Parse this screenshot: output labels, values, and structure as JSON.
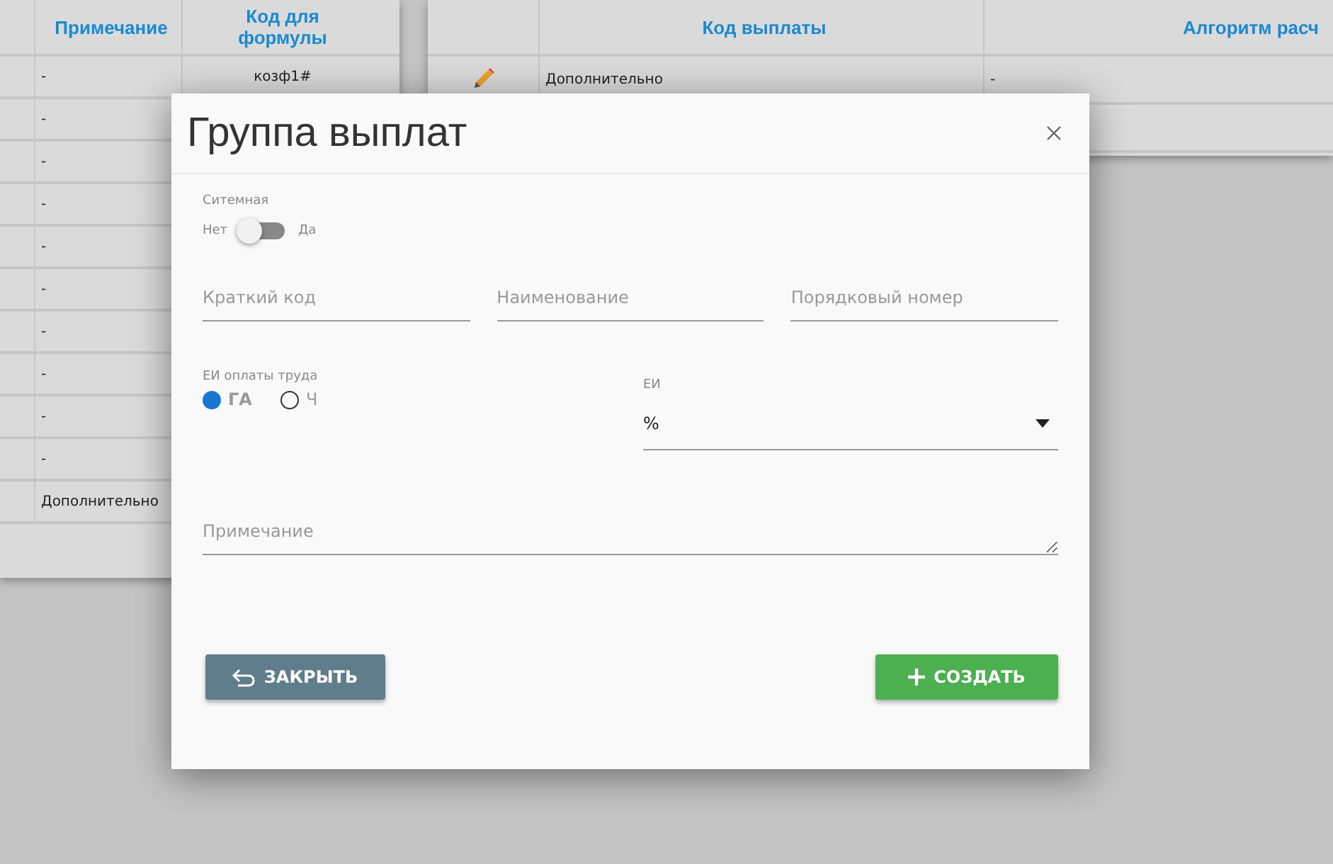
{
  "left_table": {
    "columns": [
      "Примечание",
      "Код для формулы"
    ],
    "rows": [
      {
        "cells": [
          "-",
          "козф1#"
        ]
      },
      {
        "cells": [
          "-"
        ]
      },
      {
        "cells": [
          "-"
        ]
      },
      {
        "cells": [
          "-"
        ]
      },
      {
        "cells": [
          "-"
        ]
      },
      {
        "cells": [
          "-"
        ]
      },
      {
        "cells": [
          "-"
        ]
      },
      {
        "cells": [
          "-"
        ]
      },
      {
        "cells": [
          "-"
        ]
      },
      {
        "cells": [
          "-"
        ]
      },
      {
        "cells": [
          "Дополнительно"
        ]
      }
    ]
  },
  "right_table": {
    "columns": [
      "Код выплаты",
      "Алгоритм расч"
    ],
    "rows": [
      {
        "editable": true,
        "cells": [
          "Дополнительно",
          "-"
        ]
      }
    ]
  },
  "dialog": {
    "title": "Группа выплат",
    "toggle": {
      "label": "Ситемная",
      "off_label": "Нет",
      "on_label": "Да",
      "on": false
    },
    "fields": [
      {
        "placeholder": "Краткий код"
      },
      {
        "placeholder": "Наименование"
      },
      {
        "placeholder": "Порядковый номер"
      }
    ],
    "radio_group": {
      "label": "ЕИ оплаты труда",
      "options": [
        {
          "label": "ГА",
          "selected": true
        },
        {
          "label": "Ч",
          "selected": false
        }
      ]
    },
    "select": {
      "label": "ЕИ",
      "value": "%"
    },
    "note": {
      "placeholder": "Примечание"
    },
    "buttons": [
      {
        "kind": "close",
        "label": "ЗАКРЫТЬ"
      },
      {
        "kind": "create",
        "label": "СОЗДАТЬ"
      }
    ]
  }
}
